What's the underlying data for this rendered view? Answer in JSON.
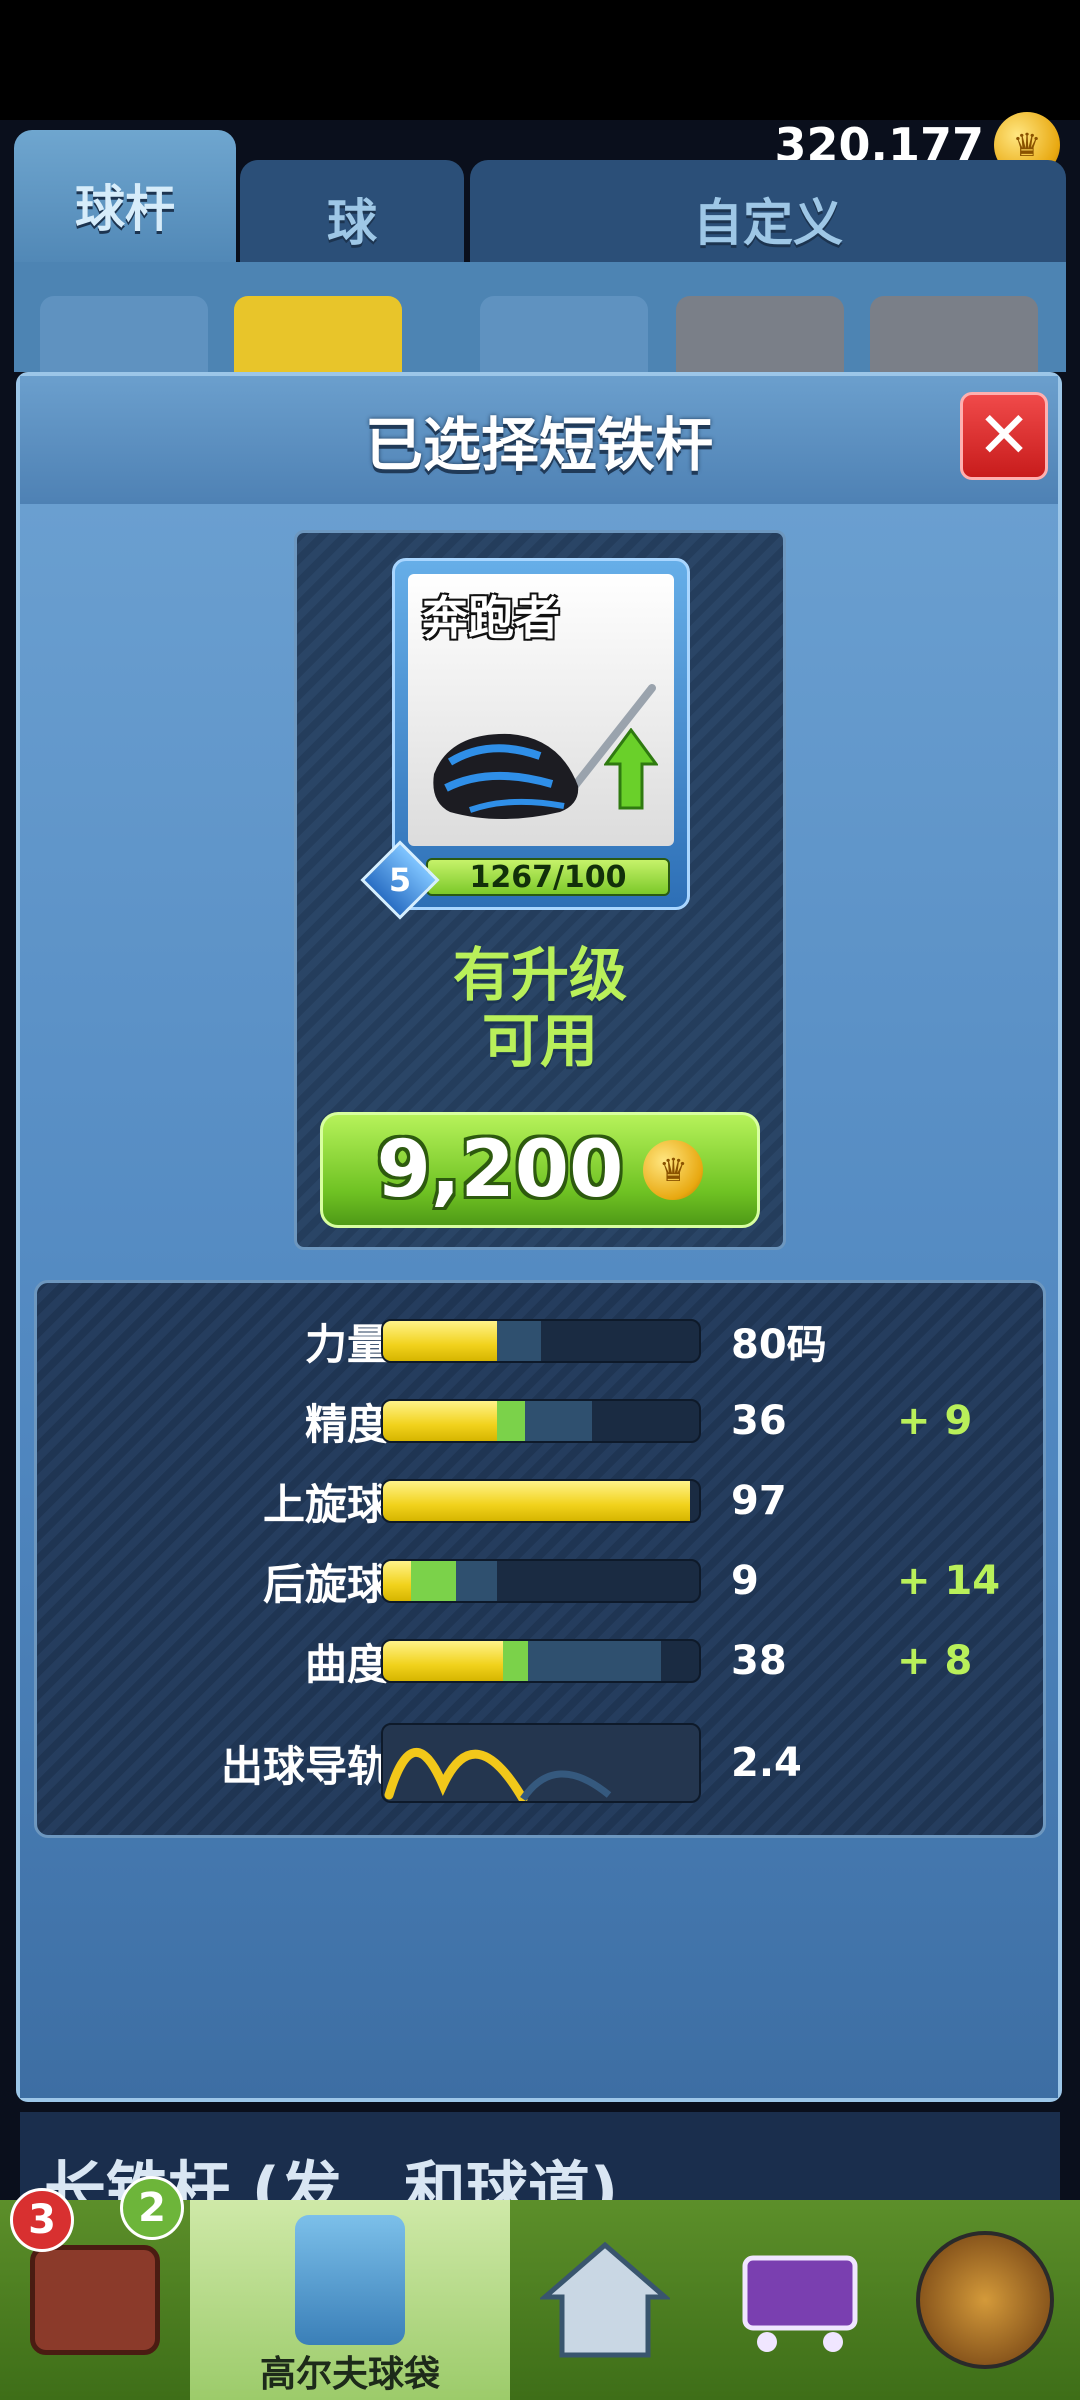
{
  "header": {
    "coins": "320,177",
    "coin_icon": "crown-coin-icon"
  },
  "tabs": [
    {
      "label": "球杆",
      "active": true
    },
    {
      "label": "球",
      "active": false
    },
    {
      "label": "自定义",
      "active": false
    }
  ],
  "dialog": {
    "title": "已选择短铁杆",
    "close_label": "✕"
  },
  "club": {
    "name": "奔跑者",
    "level": "5",
    "progress_text": "1267/100",
    "upgrade_text_1": "有升级",
    "upgrade_text_2": "可用",
    "price": "9,200"
  },
  "stats": [
    {
      "label": "力量",
      "value": "80码",
      "bonus": "",
      "level": 0.36,
      "bonus_level": 0,
      "cap": 0.5
    },
    {
      "label": "精度",
      "value": "36",
      "bonus": "+ 9",
      "level": 0.36,
      "bonus_level": 0.09,
      "cap": 0.66
    },
    {
      "label": "上旋球",
      "value": "97",
      "bonus": "",
      "level": 0.97,
      "bonus_level": 0,
      "cap": 0.97
    },
    {
      "label": "后旋球",
      "value": "9",
      "bonus": "+ 14",
      "level": 0.09,
      "bonus_level": 0.14,
      "cap": 0.36
    },
    {
      "label": "曲度",
      "value": "38",
      "bonus": "+ 8",
      "level": 0.38,
      "bonus_level": 0.08,
      "cap": 0.88
    },
    {
      "label": "出球导轨",
      "value": "2.4",
      "bonus": "",
      "level": 0.48,
      "bonus_level": 0,
      "cap": 1.0
    }
  ],
  "below": {
    "text": "长铁杆 (发…和球道)"
  },
  "nav": {
    "tv_badge_1": "3",
    "tv_badge_2": "2",
    "bag_label": "高尔夫球袋"
  },
  "colors": {
    "accent": "#b9f05a",
    "panel": "#4f86bf",
    "stat_fill": "#f1d21c"
  }
}
